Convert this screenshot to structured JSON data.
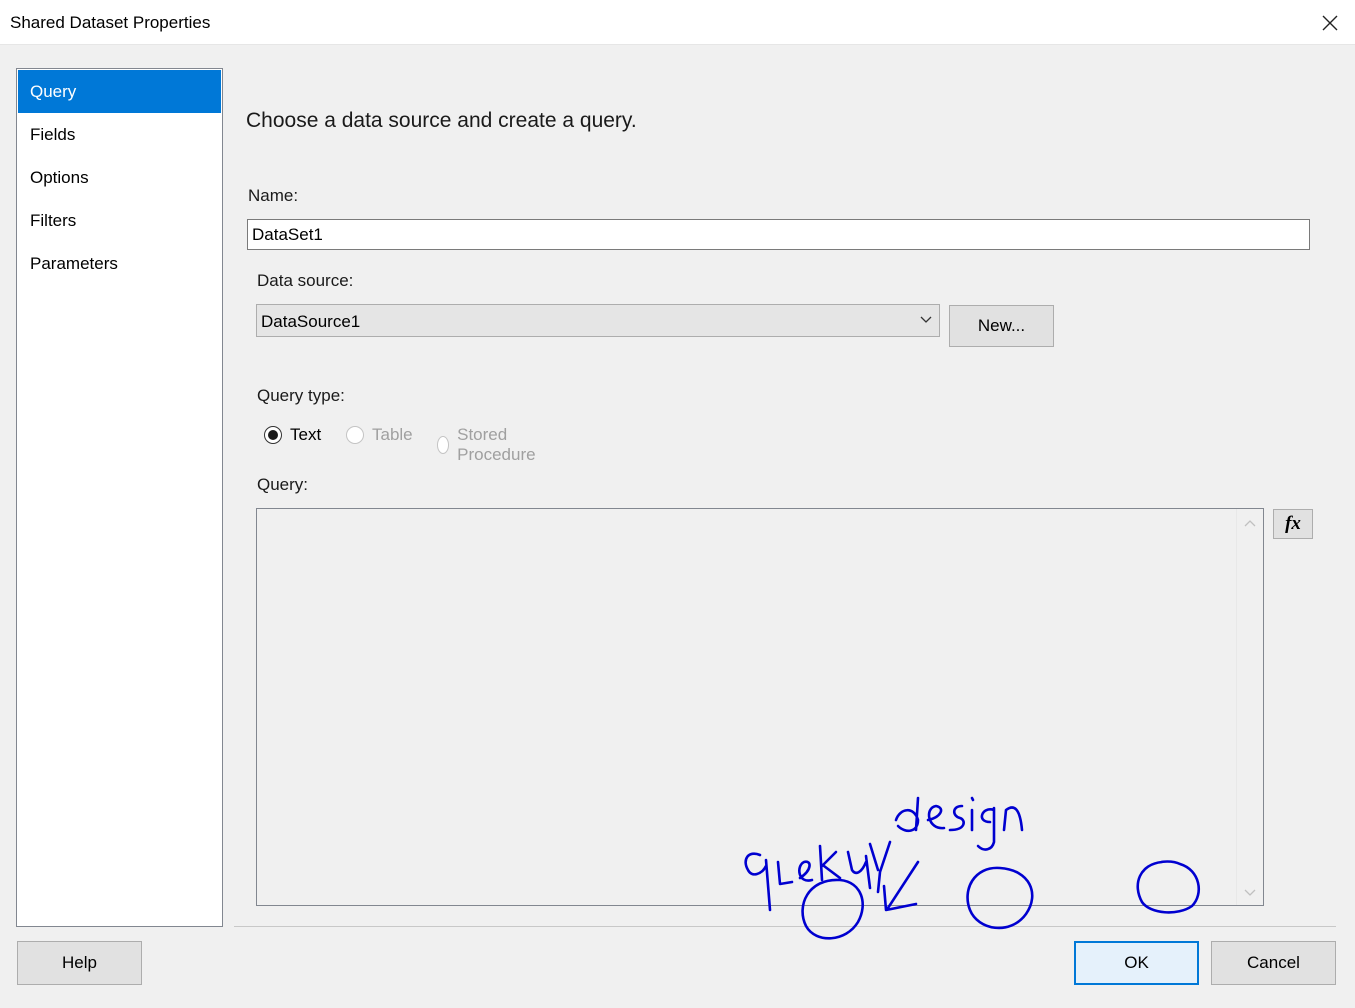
{
  "window": {
    "title": "Shared Dataset Properties"
  },
  "nav": {
    "items": [
      {
        "label": "Query",
        "selected": true
      },
      {
        "label": "Fields",
        "selected": false
      },
      {
        "label": "Options",
        "selected": false
      },
      {
        "label": "Filters",
        "selected": false
      },
      {
        "label": "Parameters",
        "selected": false
      }
    ]
  },
  "main": {
    "heading": "Choose a data source and create a query.",
    "name_label": "Name:",
    "name_value": "DataSet1",
    "datasource_label": "Data source:",
    "datasource_value": "DataSource1",
    "new_button": "New...",
    "query_type_label": "Query type:",
    "query_types": [
      {
        "label": "Text",
        "checked": true,
        "enabled": true
      },
      {
        "label": "Table",
        "checked": false,
        "enabled": false
      },
      {
        "label": "Stored Procedure",
        "checked": false,
        "enabled": false
      }
    ],
    "query_label": "Query:",
    "query_value": "",
    "fx_button": "fx"
  },
  "footer": {
    "help_button": "Help",
    "ok_button": "OK",
    "cancel_button": "Cancel"
  },
  "annotation": {
    "color": "#0000d0",
    "query_word": "query",
    "design_word": "design"
  },
  "colors": {
    "selection": "#0078d7",
    "background": "#f0f0f0"
  }
}
